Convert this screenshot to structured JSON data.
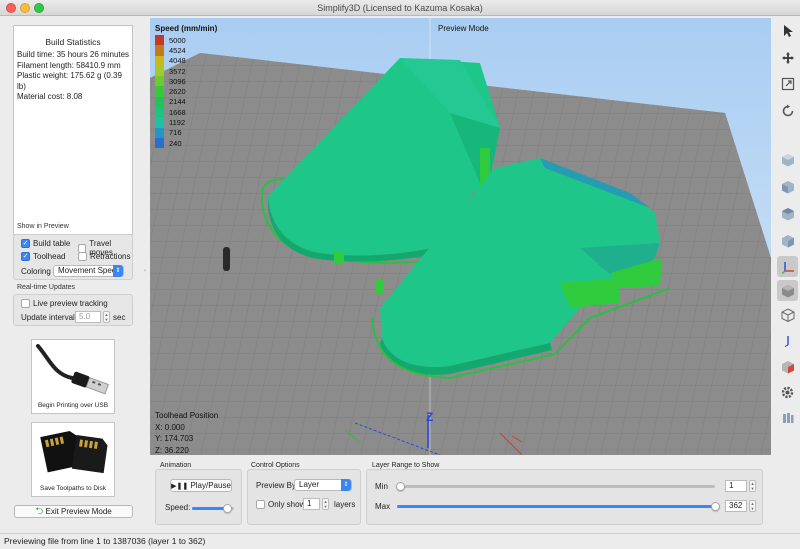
{
  "window": {
    "title": "Simplify3D (Licensed to Kazuma Kosaka)"
  },
  "build_statistics": {
    "title": "Build Statistics",
    "lines": [
      "Build time: 35 hours 26 minutes",
      "Filament length: 58410.9 mm",
      "Plastic weight: 175.62 g (0.39 lb)",
      "Material cost: 8.08"
    ]
  },
  "show_in_preview": {
    "label": "Show in Preview",
    "build_table": {
      "label": "Build table",
      "checked": true
    },
    "travel_moves": {
      "label": "Travel moves",
      "checked": false
    },
    "toolhead": {
      "label": "Toolhead",
      "checked": true
    },
    "retractions": {
      "label": "Retractions",
      "checked": false
    },
    "coloring_label": "Coloring",
    "coloring_value": "Movement Speed"
  },
  "realtime": {
    "label": "Real-time Updates",
    "live_tracking_label": "Live preview tracking",
    "live_tracking_checked": false,
    "interval_label": "Update interval",
    "interval_value": "5.0",
    "interval_unit": "sec"
  },
  "actions": {
    "usb_label": "Begin Printing over USB",
    "disk_label": "Save Toolpaths to Disk",
    "exit_label": "Exit Preview Mode"
  },
  "viewport": {
    "mode_label": "Preview Mode",
    "legend_title": "Speed (mm/min)",
    "legend": [
      {
        "value": "5000",
        "color": "#c0392b"
      },
      {
        "value": "4524",
        "color": "#c47a1c"
      },
      {
        "value": "4048",
        "color": "#c8b81a"
      },
      {
        "value": "3572",
        "color": "#a4c92a"
      },
      {
        "value": "3096",
        "color": "#6ccc2f"
      },
      {
        "value": "2620",
        "color": "#34c83a"
      },
      {
        "value": "2144",
        "color": "#22c45a"
      },
      {
        "value": "1668",
        "color": "#1fc27e"
      },
      {
        "value": "1192",
        "color": "#21bfa3"
      },
      {
        "value": "716",
        "color": "#2596c4"
      },
      {
        "value": "240",
        "color": "#2a6fd0"
      }
    ],
    "toolhead_title": "Toolhead Position",
    "toolhead_x": "X: 0.000",
    "toolhead_y": "Y: 174.703",
    "toolhead_z": "Z: 36.220",
    "axis_z_label": "Z"
  },
  "animation": {
    "label": "Animation",
    "play_label": "Play/Pause",
    "speed_label": "Speed:",
    "speed_fraction": 0.85
  },
  "control_options": {
    "label": "Control Options",
    "preview_by_label": "Preview By",
    "preview_by_value": "Layer",
    "only_show_label": "Only show",
    "only_show_checked": false,
    "only_show_value": "1",
    "layers_label": "layers"
  },
  "layer_range": {
    "label": "Layer Range to Show",
    "min_label": "Min",
    "min_value": "1",
    "max_label": "Max",
    "max_value": "362"
  },
  "status": {
    "text": "Previewing file from line 1 to 1387036 (layer 1 to 362)"
  }
}
